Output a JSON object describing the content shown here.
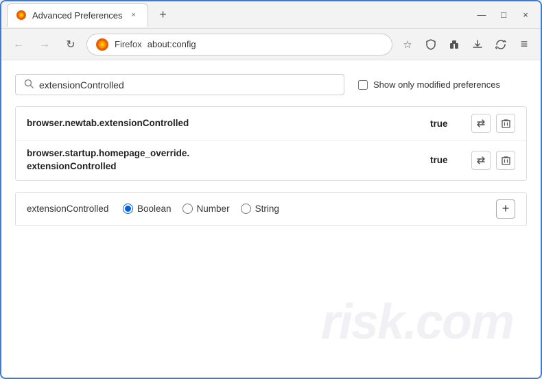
{
  "window": {
    "title": "Advanced Preferences",
    "tab_close": "×",
    "new_tab": "+",
    "min_btn": "—",
    "max_btn": "□",
    "close_btn": "×"
  },
  "navbar": {
    "back_btn": "←",
    "forward_btn": "→",
    "reload_btn": "↻",
    "browser_label": "Firefox",
    "url": "about:config",
    "bookmark_icon": "☆",
    "shield_icon": "🛡",
    "extension_icon": "🧩",
    "menu_icon": "≡"
  },
  "search": {
    "placeholder": "",
    "value": "extensionControlled",
    "checkbox_label": "Show only modified preferences"
  },
  "results": [
    {
      "name": "browser.newtab.extensionControlled",
      "value": "true"
    },
    {
      "name_line1": "browser.startup.homepage_override.",
      "name_line2": "extensionControlled",
      "value": "true"
    }
  ],
  "new_pref": {
    "name": "extensionControlled",
    "type_boolean": "Boolean",
    "type_number": "Number",
    "type_string": "String",
    "add_btn": "+"
  },
  "watermark": "risk.com"
}
